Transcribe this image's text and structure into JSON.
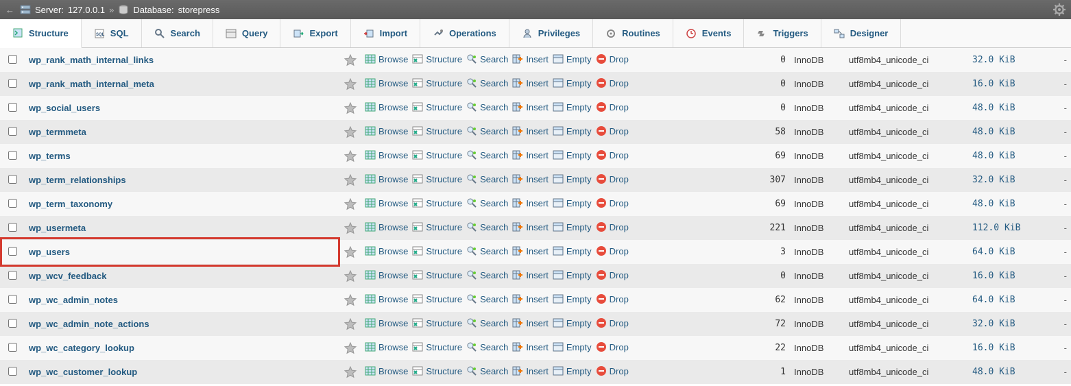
{
  "breadcrumb": {
    "server_label": "Server:",
    "server_value": "127.0.0.1",
    "database_label": "Database:",
    "database_value": "storepress"
  },
  "tabs": [
    {
      "label": "Structure",
      "icon": "structure"
    },
    {
      "label": "SQL",
      "icon": "sql"
    },
    {
      "label": "Search",
      "icon": "search"
    },
    {
      "label": "Query",
      "icon": "query"
    },
    {
      "label": "Export",
      "icon": "export"
    },
    {
      "label": "Import",
      "icon": "import"
    },
    {
      "label": "Operations",
      "icon": "operations"
    },
    {
      "label": "Privileges",
      "icon": "privileges"
    },
    {
      "label": "Routines",
      "icon": "routines"
    },
    {
      "label": "Events",
      "icon": "events"
    },
    {
      "label": "Triggers",
      "icon": "triggers"
    },
    {
      "label": "Designer",
      "icon": "designer"
    }
  ],
  "action_labels": {
    "browse": "Browse",
    "structure": "Structure",
    "search": "Search",
    "insert": "Insert",
    "empty": "Empty",
    "drop": "Drop"
  },
  "rows": [
    {
      "name": "wp_rank_math_internal_links",
      "rows": "0",
      "engine": "InnoDB",
      "collation": "utf8mb4_unicode_ci",
      "size": "32.0 KiB",
      "overhead": "-"
    },
    {
      "name": "wp_rank_math_internal_meta",
      "rows": "0",
      "engine": "InnoDB",
      "collation": "utf8mb4_unicode_ci",
      "size": "16.0 KiB",
      "overhead": "-"
    },
    {
      "name": "wp_social_users",
      "rows": "0",
      "engine": "InnoDB",
      "collation": "utf8mb4_unicode_ci",
      "size": "48.0 KiB",
      "overhead": "-"
    },
    {
      "name": "wp_termmeta",
      "rows": "58",
      "engine": "InnoDB",
      "collation": "utf8mb4_unicode_ci",
      "size": "48.0 KiB",
      "overhead": "-"
    },
    {
      "name": "wp_terms",
      "rows": "69",
      "engine": "InnoDB",
      "collation": "utf8mb4_unicode_ci",
      "size": "48.0 KiB",
      "overhead": "-"
    },
    {
      "name": "wp_term_relationships",
      "rows": "307",
      "engine": "InnoDB",
      "collation": "utf8mb4_unicode_ci",
      "size": "32.0 KiB",
      "overhead": "-"
    },
    {
      "name": "wp_term_taxonomy",
      "rows": "69",
      "engine": "InnoDB",
      "collation": "utf8mb4_unicode_ci",
      "size": "48.0 KiB",
      "overhead": "-"
    },
    {
      "name": "wp_usermeta",
      "rows": "221",
      "engine": "InnoDB",
      "collation": "utf8mb4_unicode_ci",
      "size": "112.0 KiB",
      "overhead": "-"
    },
    {
      "name": "wp_users",
      "rows": "3",
      "engine": "InnoDB",
      "collation": "utf8mb4_unicode_ci",
      "size": "64.0 KiB",
      "overhead": "-",
      "highlight": true
    },
    {
      "name": "wp_wcv_feedback",
      "rows": "0",
      "engine": "InnoDB",
      "collation": "utf8mb4_unicode_ci",
      "size": "16.0 KiB",
      "overhead": "-"
    },
    {
      "name": "wp_wc_admin_notes",
      "rows": "62",
      "engine": "InnoDB",
      "collation": "utf8mb4_unicode_ci",
      "size": "64.0 KiB",
      "overhead": "-"
    },
    {
      "name": "wp_wc_admin_note_actions",
      "rows": "72",
      "engine": "InnoDB",
      "collation": "utf8mb4_unicode_ci",
      "size": "32.0 KiB",
      "overhead": "-"
    },
    {
      "name": "wp_wc_category_lookup",
      "rows": "22",
      "engine": "InnoDB",
      "collation": "utf8mb4_unicode_ci",
      "size": "16.0 KiB",
      "overhead": "-"
    },
    {
      "name": "wp_wc_customer_lookup",
      "rows": "1",
      "engine": "InnoDB",
      "collation": "utf8mb4_unicode_ci",
      "size": "48.0 KiB",
      "overhead": "-"
    }
  ]
}
